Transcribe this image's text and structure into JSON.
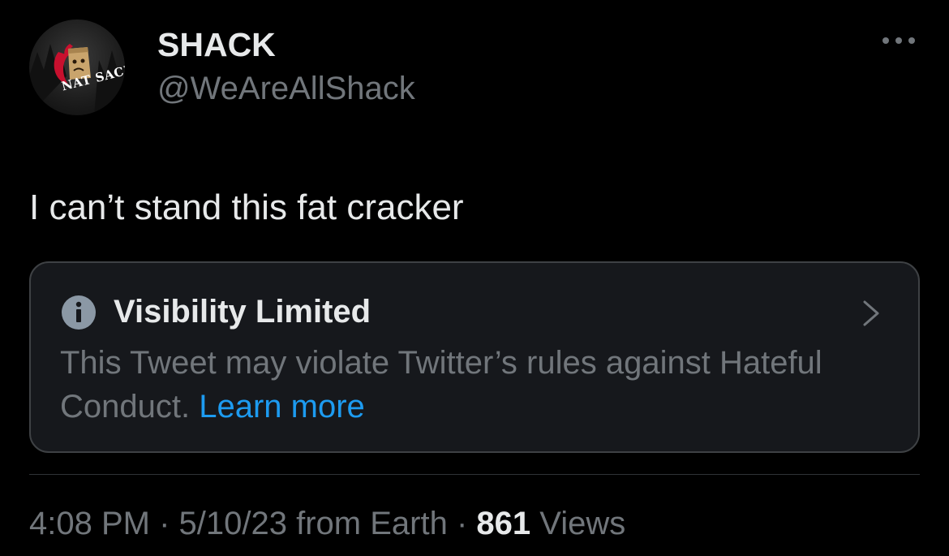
{
  "author": {
    "display_name": "SHACK",
    "handle": "@WeAreAllShack",
    "avatar_text": "NAT SACK"
  },
  "tweet": {
    "text": "I can’t stand this fat cracker"
  },
  "notice": {
    "title": "Visibility Limited",
    "body": "This Tweet may violate Twitter’s rules against Hateful Conduct.",
    "link": "Learn more"
  },
  "meta": {
    "time": "4:08 PM",
    "separator1": " · ",
    "date": "5/10/23",
    "source": " from Earth",
    "separator2": " · ",
    "views_count": "861",
    "views_label": " Views"
  },
  "colors": {
    "background": "#000000",
    "primary_text": "#e7e9ea",
    "secondary_text": "#71767b",
    "link": "#1d9bf0",
    "notice_bg": "#16181c",
    "notice_border": "#3e4144",
    "info_icon": "#8b98a5"
  },
  "icons": {
    "more": "more-horizontal-icon",
    "info": "info-icon",
    "chevron": "chevron-right-icon"
  }
}
